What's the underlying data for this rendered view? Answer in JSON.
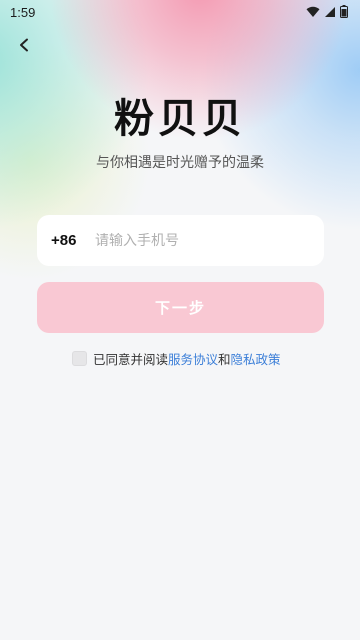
{
  "status_bar": {
    "time": "1:59",
    "icons": [
      "wifi-icon",
      "signal-icon",
      "battery-icon"
    ]
  },
  "nav": {
    "back_icon": "chevron-left-icon"
  },
  "app": {
    "title": "粉贝贝",
    "tagline": "与你相遇是时光赠予的温柔"
  },
  "login": {
    "country_code": "+86",
    "phone_placeholder": "请输入手机号",
    "phone_value": "",
    "next_label": "下一步"
  },
  "agreement": {
    "checked": false,
    "prefix": "已同意并阅读",
    "terms_link": "服务协议",
    "connector": "和",
    "privacy_link": "隐私政策"
  },
  "colors": {
    "button_disabled": "#f9c8d3",
    "link": "#3c7fd8",
    "background": "#f5f6f8"
  }
}
